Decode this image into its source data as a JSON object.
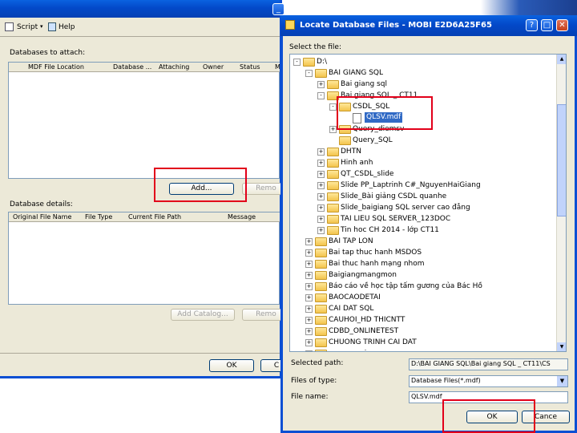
{
  "attach": {
    "toolbar_script": "Script",
    "toolbar_help": "Help",
    "databases_label": "Databases to attach:",
    "columns": [
      "MDF File Location",
      "Database ...",
      "Attaching",
      "Owner",
      "Status",
      "M"
    ],
    "add_button": "Add...",
    "remove_button": "Remo",
    "details_label": "Database details:",
    "detail_columns": [
      "Original File Name",
      "File Type",
      "Current File Path",
      "Message"
    ],
    "add_catalog_button": "Add Catalog...",
    "remove_button2": "Remo",
    "ok_button": "OK",
    "cancel_button": "C"
  },
  "dialog": {
    "title": "Locate Database Files - MOBI E2D6A25F65",
    "select_label": "Select the file:",
    "tree": [
      {
        "label": "D:\\",
        "depth": 0,
        "exp": "-",
        "type": "folder"
      },
      {
        "label": "BAI GIANG SQL",
        "depth": 1,
        "exp": "-",
        "type": "folder"
      },
      {
        "label": "Bai giang sql",
        "depth": 2,
        "exp": "+",
        "type": "folder"
      },
      {
        "label": "Bai giang SQL _ CT11",
        "depth": 2,
        "exp": "-",
        "type": "folder"
      },
      {
        "label": "CSDL_SQL",
        "depth": 3,
        "exp": "-",
        "type": "folder"
      },
      {
        "label": "QLSV.mdf",
        "depth": 4,
        "exp": "",
        "type": "file",
        "selected": true
      },
      {
        "label": "Query_diemsv",
        "depth": 3,
        "exp": "+",
        "type": "folder"
      },
      {
        "label": "Query_SQL",
        "depth": 3,
        "exp": "",
        "type": "folder"
      },
      {
        "label": "DHTN",
        "depth": 2,
        "exp": "+",
        "type": "folder"
      },
      {
        "label": "Hinh anh",
        "depth": 2,
        "exp": "+",
        "type": "folder"
      },
      {
        "label": "QT_CSDL_slide",
        "depth": 2,
        "exp": "+",
        "type": "folder"
      },
      {
        "label": "Slide PP_Laptrinh C#_NguyenHaiGiang",
        "depth": 2,
        "exp": "+",
        "type": "folder"
      },
      {
        "label": "Slide_Bài giảng CSDL quanhe",
        "depth": 2,
        "exp": "+",
        "type": "folder"
      },
      {
        "label": "Slide_baigiang SQL server cao đẳng",
        "depth": 2,
        "exp": "+",
        "type": "folder"
      },
      {
        "label": "TAI LIEU SQL SERVER_123DOC",
        "depth": 2,
        "exp": "+",
        "type": "folder"
      },
      {
        "label": "Tin hoc CH 2014 - lớp CT11",
        "depth": 2,
        "exp": "+",
        "type": "folder"
      },
      {
        "label": "BAI TAP LON",
        "depth": 1,
        "exp": "+",
        "type": "folder"
      },
      {
        "label": "Bai tap thuc hanh MSDOS",
        "depth": 1,
        "exp": "+",
        "type": "folder"
      },
      {
        "label": "Bai thuc hanh mạng nhom",
        "depth": 1,
        "exp": "+",
        "type": "folder"
      },
      {
        "label": "Baigiangmangmon",
        "depth": 1,
        "exp": "+",
        "type": "folder"
      },
      {
        "label": "Báo cáo về học tập tấm gương của Bác Hồ",
        "depth": 1,
        "exp": "+",
        "type": "folder"
      },
      {
        "label": "BAOCAODETAI",
        "depth": 1,
        "exp": "+",
        "type": "folder"
      },
      {
        "label": "CAI DAT SQL",
        "depth": 1,
        "exp": "+",
        "type": "folder"
      },
      {
        "label": "CAUHOI_HD THICNTT",
        "depth": 1,
        "exp": "+",
        "type": "folder"
      },
      {
        "label": "CDBD_ONLINETEST",
        "depth": 1,
        "exp": "+",
        "type": "folder"
      },
      {
        "label": "CHUONG TRINH CAI DAT",
        "depth": 1,
        "exp": "+",
        "type": "folder"
      },
      {
        "label": "cuong mai",
        "depth": 1,
        "exp": "+",
        "type": "folder"
      }
    ],
    "selected_path_label": "Selected path:",
    "selected_path_value": "D:\\BAI GIANG SQL\\Bai giang SQL _ CT11\\CS",
    "files_type_label": "Files of type:",
    "files_type_value": "Database Files(*.mdf)",
    "file_name_label": "File name:",
    "file_name_value": "QLSV.mdf",
    "ok_button": "OK",
    "cancel_button": "Cance"
  }
}
